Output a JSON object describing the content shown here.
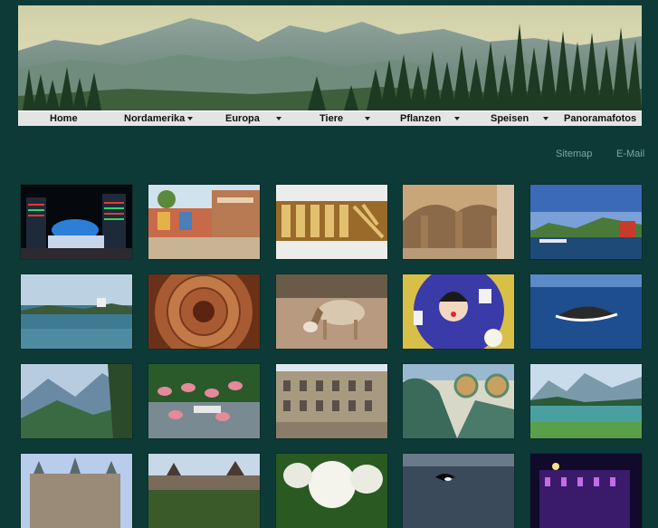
{
  "nav": {
    "items": [
      {
        "label": "Home",
        "dropdown": false
      },
      {
        "label": "Nordamerika",
        "dropdown": true
      },
      {
        "label": "Europa",
        "dropdown": true
      },
      {
        "label": "Tiere",
        "dropdown": true
      },
      {
        "label": "Pflanzen",
        "dropdown": true
      },
      {
        "label": "Speisen",
        "dropdown": true
      },
      {
        "label": "Panoramafotos",
        "dropdown": false
      }
    ]
  },
  "utility": {
    "sitemap": "Sitemap",
    "email": "E-Mail"
  },
  "colors": {
    "background": "#0d3a36",
    "nav_bg": "#e4e4e4",
    "link": "#7fa5a0"
  },
  "gallery": {
    "thumbnails": [
      "night-illuminated-building",
      "colorful-town-square",
      "ornate-golden-panels",
      "stone-arched-colonnade",
      "lake-harbor-with-boats",
      "island-lighthouse-sea",
      "wooden-ceiling-dome",
      "goat-grazing",
      "flower-display-face-fan",
      "whale-in-ocean",
      "mountain-valley-forest",
      "flamingos-in-pond",
      "classical-palace-facade",
      "green-sculptures-coins",
      "alpine-lake-reflection",
      "castle-towers",
      "castle-on-hill",
      "white-flowers-closeup",
      "orca-in-sea",
      "purple-lit-building-night"
    ]
  }
}
